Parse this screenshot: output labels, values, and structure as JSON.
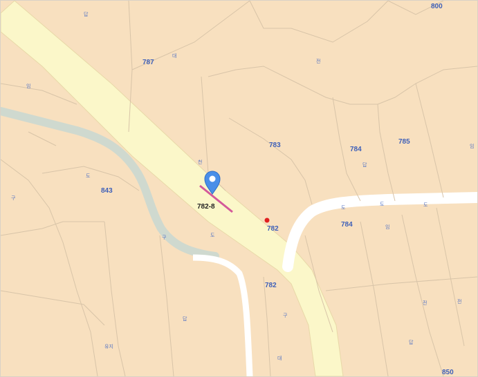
{
  "map": {
    "selected_parcel_label": "782-8",
    "parcel_numbers": [
      "800",
      "787",
      "785",
      "784",
      "783",
      "843",
      "784",
      "782",
      "782",
      "850"
    ],
    "small_labels": [
      "답",
      "대",
      "전",
      "임",
      "도",
      "구",
      "천",
      "유지"
    ]
  },
  "colors": {
    "land": "#f8e0bf",
    "road": "#fbf7c9",
    "stream": "#cfd9cf",
    "parcel_line": "#d7c3a6",
    "marker": "#4a8fe8",
    "highlight_line": "#d45a9a",
    "point": "#e02020"
  },
  "icons": {
    "marker": "map-pin-icon",
    "point": "location-dot-icon"
  }
}
